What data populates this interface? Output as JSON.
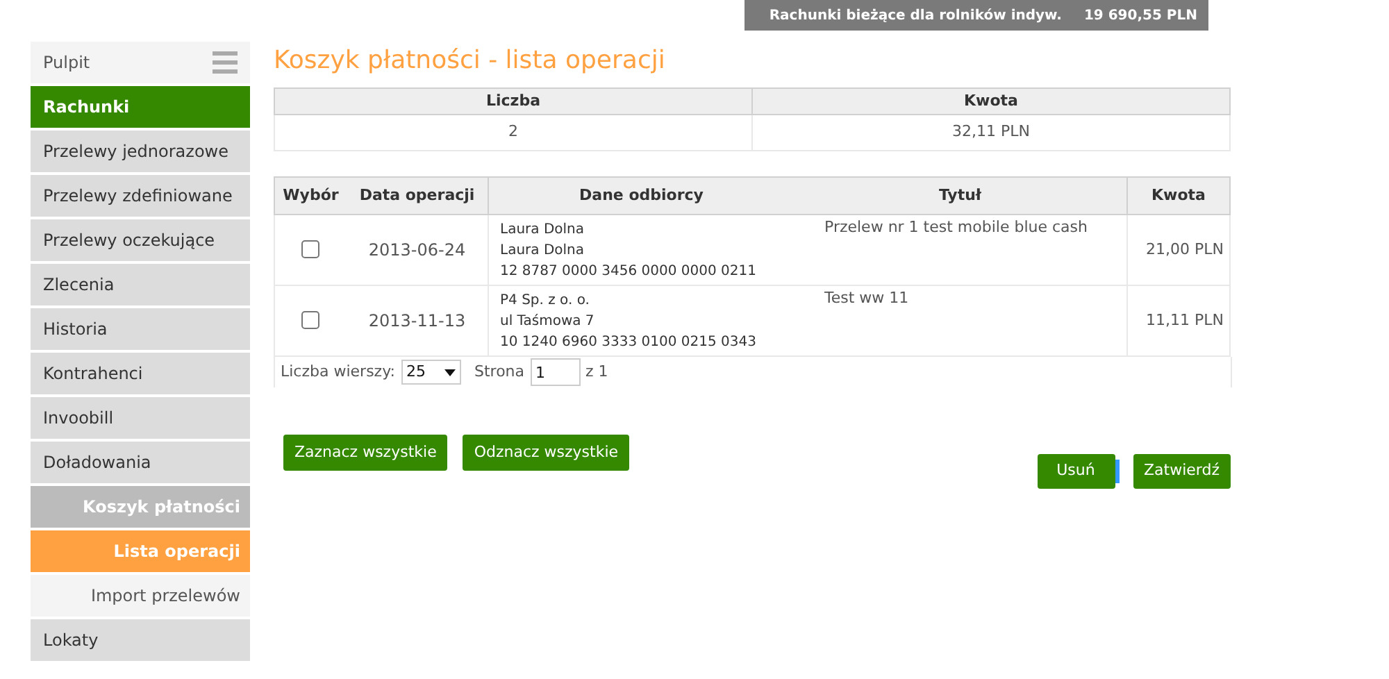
{
  "account_bar": {
    "name": "Rachunki bieżące dla rolników indyw.",
    "balance": "19 690,55 PLN"
  },
  "sidebar": {
    "items": [
      {
        "label": "Pulpit",
        "kind": "top",
        "selected": false
      },
      {
        "label": "Rachunki",
        "kind": "section",
        "selected": true
      },
      {
        "label": "Przelewy jednorazowe",
        "kind": "section",
        "selected": false
      },
      {
        "label": "Przelewy zdefiniowane",
        "kind": "section",
        "selected": false
      },
      {
        "label": "Przelewy oczekujące",
        "kind": "section",
        "selected": false
      },
      {
        "label": "Zlecenia",
        "kind": "section",
        "selected": false
      },
      {
        "label": "Historia",
        "kind": "section",
        "selected": false
      },
      {
        "label": "Kontrahenci",
        "kind": "section",
        "selected": false
      },
      {
        "label": "Invoobill",
        "kind": "section",
        "selected": false
      },
      {
        "label": "Doładowania",
        "kind": "section",
        "selected": false
      },
      {
        "label": "Koszyk płatności",
        "kind": "group",
        "selected": false
      },
      {
        "label": "Lista operacji",
        "kind": "sub",
        "selected": true
      },
      {
        "label": "Import przelewów",
        "kind": "sub",
        "selected": false
      },
      {
        "label": "Lokaty",
        "kind": "section",
        "selected": false
      }
    ]
  },
  "title": "Koszyk płatności - lista operacji",
  "summary": {
    "columns": [
      "Liczba",
      "Kwota"
    ],
    "row": [
      "2",
      "32,11 PLN"
    ]
  },
  "operations": {
    "columns": [
      "Wybór",
      "Data operacji",
      "Dane odbiorcy",
      "Tytuł",
      "Kwota"
    ],
    "rows": [
      {
        "checked": false,
        "date": "2013-06-24",
        "recipient": [
          "Laura Dolna",
          "Laura Dolna",
          "12 8787 0000 3456 0000 0000 0211"
        ],
        "title": "Przelew nr 1 test mobile blue cash",
        "amount": "21,00 PLN"
      },
      {
        "checked": false,
        "date": "2013-11-13",
        "recipient": [
          "P4 Sp. z o. o.",
          "ul Taśmowa 7",
          "10 1240 6960 3333 0100 0215 0343"
        ],
        "title": "Test ww 11",
        "amount": "11,11 PLN"
      }
    ]
  },
  "pager": {
    "rows_label": "Liczba wierszy:",
    "rows_value": "25",
    "page_label": "Strona",
    "page_value": "1",
    "page_total": "z 1"
  },
  "select_buttons": [
    "Zaznacz wszystkie",
    "Odznacz wszystkie"
  ],
  "action_buttons": [
    "Usuń",
    "Zatwierdź"
  ]
}
